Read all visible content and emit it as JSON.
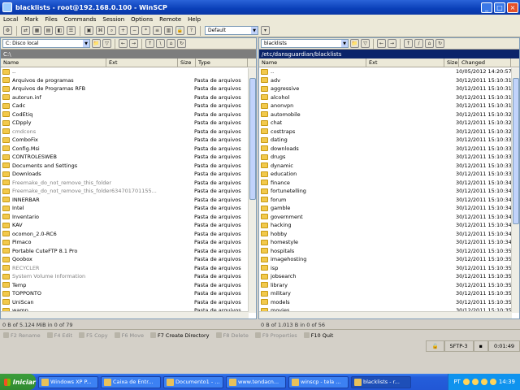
{
  "window": {
    "title": "blacklists - root@192.168.0.100 - WinSCP"
  },
  "menu": [
    "Local",
    "Mark",
    "Files",
    "Commands",
    "Session",
    "Options",
    "Remote",
    "Help"
  ],
  "toolbar": {
    "transfer_preset": "Default"
  },
  "left": {
    "drive": "C: Disco local",
    "path": "C:\\",
    "columns": {
      "name": "Name",
      "ext": "Ext",
      "size": "Size",
      "type": "Type"
    },
    "items": [
      {
        "name": "..",
        "type": "",
        "gray": false
      },
      {
        "name": "Arquivos de programas",
        "type": "Pasta de arquivos",
        "gray": false
      },
      {
        "name": "Arquivos de Programas RFB",
        "type": "Pasta de arquivos",
        "gray": false
      },
      {
        "name": "autorun.inf",
        "type": "Pasta de arquivos",
        "gray": false
      },
      {
        "name": "Cadc",
        "type": "Pasta de arquivos",
        "gray": false
      },
      {
        "name": "CodEtiq",
        "type": "Pasta de arquivos",
        "gray": false
      },
      {
        "name": "CDpply",
        "type": "Pasta de arquivos",
        "gray": false
      },
      {
        "name": "cmdcons",
        "type": "Pasta de arquivos",
        "gray": true
      },
      {
        "name": "ComboFix",
        "type": "Pasta de arquivos",
        "gray": false
      },
      {
        "name": "Config.Msi",
        "type": "Pasta de arquivos",
        "gray": false
      },
      {
        "name": "CONTROLESWEB",
        "type": "Pasta de arquivos",
        "gray": false
      },
      {
        "name": "Documents and Settings",
        "type": "Pasta de arquivos",
        "gray": false
      },
      {
        "name": "Downloads",
        "type": "Pasta de arquivos",
        "gray": false
      },
      {
        "name": "Freemake_do_not_remove_this_folder",
        "type": "Pasta de arquivos",
        "gray": true
      },
      {
        "name": "Freemake_do_not_remove_this_folder634701701155...",
        "type": "Pasta de arquivos",
        "gray": true
      },
      {
        "name": "INNERBAR",
        "type": "Pasta de arquivos",
        "gray": false
      },
      {
        "name": "Intel",
        "type": "Pasta de arquivos",
        "gray": false
      },
      {
        "name": "Inventario",
        "type": "Pasta de arquivos",
        "gray": false
      },
      {
        "name": "KAV",
        "type": "Pasta de arquivos",
        "gray": false
      },
      {
        "name": "ocomon_2.0-RC6",
        "type": "Pasta de arquivos",
        "gray": false
      },
      {
        "name": "Pimaco",
        "type": "Pasta de arquivos",
        "gray": false
      },
      {
        "name": "Portable CuteFTP 8.1 Pro",
        "type": "Pasta de arquivos",
        "gray": false
      },
      {
        "name": "Qoobox",
        "type": "Pasta de arquivos",
        "gray": false
      },
      {
        "name": "RECYCLER",
        "type": "Pasta de arquivos",
        "gray": true
      },
      {
        "name": "System Volume Information",
        "type": "Pasta de arquivos",
        "gray": true
      },
      {
        "name": "Temp",
        "type": "Pasta de arquivos",
        "gray": false
      },
      {
        "name": "TOPPONTO",
        "type": "Pasta de arquivos",
        "gray": false
      },
      {
        "name": "UniScan",
        "type": "Pasta de arquivos",
        "gray": false
      },
      {
        "name": "wamp",
        "type": "Pasta de arquivos",
        "gray": false
      },
      {
        "name": "WINDOWS",
        "type": "Pasta de arquivos",
        "gray": false
      },
      {
        "name": "Xcript",
        "type": "Pasta de arquivos",
        "gray": false
      }
    ],
    "status": "0 B of 5.124 MiB in 0 of 79"
  },
  "right": {
    "folder": "blacklists",
    "path": "/etc/dansguardian/blacklists",
    "columns": {
      "name": "Name",
      "ext": "Ext",
      "size": "Size",
      "changed": "Changed"
    },
    "items": [
      {
        "name": "..",
        "changed": "10/05/2012 14:20:57"
      },
      {
        "name": "adv",
        "changed": "30/12/2011 15:10:31"
      },
      {
        "name": "aggressive",
        "changed": "30/12/2011 15:10:31"
      },
      {
        "name": "alcohol",
        "changed": "30/12/2011 15:10:31"
      },
      {
        "name": "anonvpn",
        "changed": "30/12/2011 15:10:31"
      },
      {
        "name": "automobile",
        "changed": "30/12/2011 15:10:32"
      },
      {
        "name": "chat",
        "changed": "30/12/2011 15:10:32"
      },
      {
        "name": "costtraps",
        "changed": "30/12/2011 15:10:32"
      },
      {
        "name": "dating",
        "changed": "30/12/2011 15:10:33"
      },
      {
        "name": "downloads",
        "changed": "30/12/2011 15:10:33"
      },
      {
        "name": "drugs",
        "changed": "30/12/2011 15:10:33"
      },
      {
        "name": "dynamic",
        "changed": "30/12/2011 15:10:33"
      },
      {
        "name": "education",
        "changed": "30/12/2011 15:10:33"
      },
      {
        "name": "finance",
        "changed": "30/12/2011 15:10:34"
      },
      {
        "name": "fortunetelling",
        "changed": "30/12/2011 15:10:34"
      },
      {
        "name": "forum",
        "changed": "30/12/2011 15:10:34"
      },
      {
        "name": "gamble",
        "changed": "30/12/2011 15:10:34"
      },
      {
        "name": "government",
        "changed": "30/12/2011 15:10:34"
      },
      {
        "name": "hacking",
        "changed": "30/12/2011 15:10:34"
      },
      {
        "name": "hobby",
        "changed": "30/12/2011 15:10:34"
      },
      {
        "name": "homestyle",
        "changed": "30/12/2011 15:10:34"
      },
      {
        "name": "hospitals",
        "changed": "30/12/2011 15:10:35"
      },
      {
        "name": "imagehosting",
        "changed": "30/12/2011 15:10:35"
      },
      {
        "name": "isp",
        "changed": "30/12/2011 15:10:35"
      },
      {
        "name": "jobsearch",
        "changed": "30/12/2011 15:10:35"
      },
      {
        "name": "library",
        "changed": "30/12/2011 15:10:35"
      },
      {
        "name": "military",
        "changed": "30/12/2011 15:10:35"
      },
      {
        "name": "models",
        "changed": "30/12/2011 15:10:35"
      },
      {
        "name": "movies",
        "changed": "30/12/2011 15:10:35"
      },
      {
        "name": "music",
        "changed": "30/12/2011 15:10:36"
      },
      {
        "name": "news",
        "changed": "30/12/2011 15:10:36"
      }
    ],
    "status": "0 B of 1.013 B in 0 of 56"
  },
  "fkeys": [
    {
      "label": "F2 Rename",
      "enabled": false
    },
    {
      "label": "F4 Edit",
      "enabled": false
    },
    {
      "label": "F5 Copy",
      "enabled": false
    },
    {
      "label": "F6 Move",
      "enabled": false
    },
    {
      "label": "F7 Create Directory",
      "enabled": true
    },
    {
      "label": "F8 Delete",
      "enabled": false
    },
    {
      "label": "F9 Properties",
      "enabled": false
    },
    {
      "label": "F10 Quit",
      "enabled": true
    }
  ],
  "statusbar": {
    "protocol": "SFTP-3",
    "elapsed": "0:01:49"
  },
  "taskbar": {
    "start": "Iniciar",
    "tasks": [
      "Windows XP P...",
      "Caixa de Entr...",
      "Documento1 - ...",
      "www.tendacn...",
      "winscp - tela ...",
      "blacklists - r..."
    ],
    "active_index": 5,
    "lang": "PT",
    "clock": "14:39"
  }
}
